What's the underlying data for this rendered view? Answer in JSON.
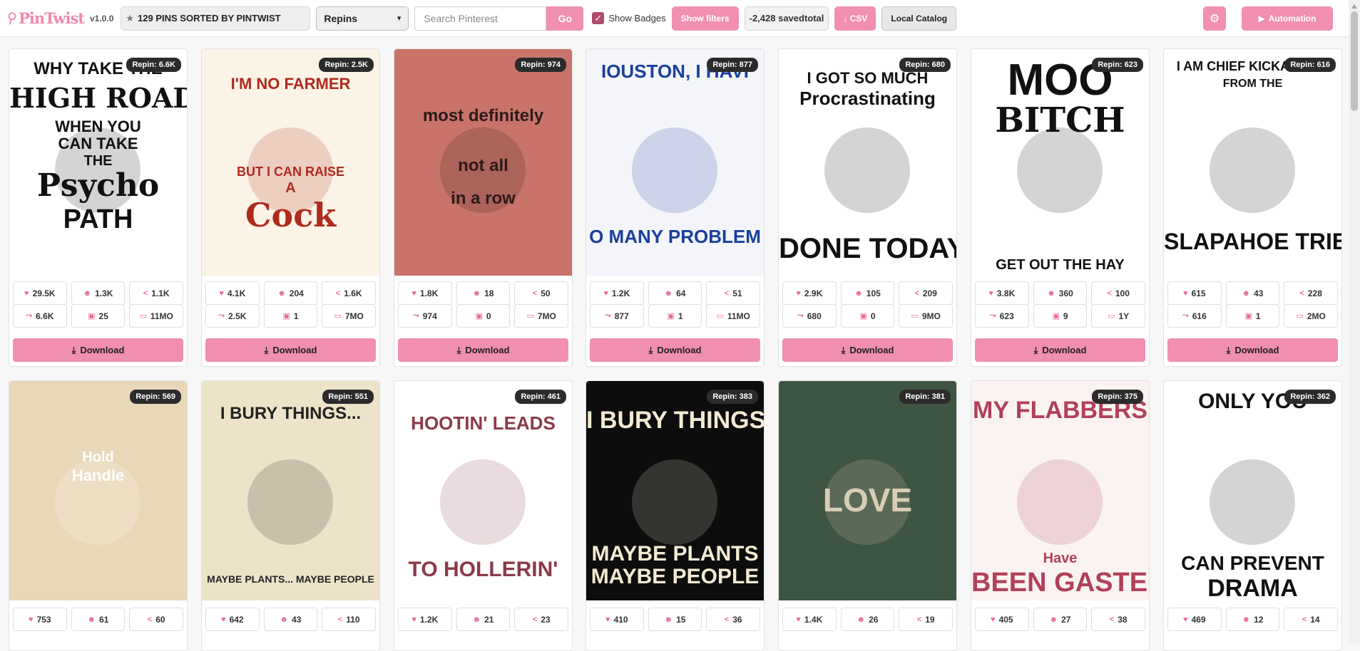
{
  "header": {
    "logo": "PinTwist",
    "version": "v1.0.0",
    "sort_info": "129 PINS SORTED BY PINTWIST",
    "sort_select": "Repins",
    "search_placeholder": "Search Pinterest",
    "go_label": "Go",
    "show_badges_label": "Show Badges",
    "show_filters_label": "Show filters",
    "saved_total": "-2,428 savedtotal",
    "csv_label": "↓ CSV",
    "local_catalog_label": "Local Catalog",
    "automation_label": "Automation"
  },
  "download_label": "Download",
  "pins": [
    {
      "repin": "Repin: 6.6K",
      "likes": "29.5K",
      "reactions": "1.3K",
      "shares": "1.1K",
      "repins": "6.6K",
      "comments": "25",
      "age": "11MO",
      "lines": [
        "WHY TAKE THE",
        "HIGH ROAD?",
        "WHEN YOU",
        "CAN TAKE",
        "THE",
        "Psycho",
        "PATH"
      ]
    },
    {
      "repin": "Repin: 2.5K",
      "likes": "4.1K",
      "reactions": "204",
      "shares": "1.6K",
      "repins": "2.5K",
      "comments": "1",
      "age": "7MO",
      "lines": [
        "I'M NO FARMER",
        "BUT I CAN RAISE",
        "A",
        "Cock"
      ]
    },
    {
      "repin": "Repin: 974",
      "likes": "1.8K",
      "reactions": "18",
      "shares": "50",
      "repins": "974",
      "comments": "0",
      "age": "7MO",
      "lines": [
        "most definitely",
        "not all",
        "in a row"
      ]
    },
    {
      "repin": "Repin: 877",
      "likes": "1.2K",
      "reactions": "64",
      "shares": "51",
      "repins": "877",
      "comments": "1",
      "age": "11MO",
      "lines": [
        "IOUSTON, I HAVI",
        "O MANY PROBLEM"
      ]
    },
    {
      "repin": "Repin: 680",
      "likes": "2.9K",
      "reactions": "105",
      "shares": "209",
      "repins": "680",
      "comments": "0",
      "age": "9MO",
      "lines": [
        "I GOT SO MUCH",
        "Procrastinating",
        "DONE TODAY"
      ]
    },
    {
      "repin": "Repin: 623",
      "likes": "3.8K",
      "reactions": "360",
      "shares": "100",
      "repins": "623",
      "comments": "9",
      "age": "1Y",
      "lines": [
        "MOO",
        "BITCH",
        "GET OUT THE HAY"
      ]
    },
    {
      "repin": "Repin: 616",
      "likes": "615",
      "reactions": "43",
      "shares": "228",
      "repins": "616",
      "comments": "1",
      "age": "2MO",
      "lines": [
        "I AM CHIEF KICKABITCH",
        "FROM THE",
        "SLAPAHOE TRIBE"
      ]
    },
    {
      "repin": "Repin: 569",
      "likes": "753",
      "reactions": "61",
      "shares": "60",
      "lines": [
        "Hold",
        "Handle"
      ]
    },
    {
      "repin": "Repin: 551",
      "likes": "642",
      "reactions": "43",
      "shares": "110",
      "lines": [
        "I BURY THINGS...",
        "MAYBE PLANTS... MAYBE PEOPLE"
      ]
    },
    {
      "repin": "Repin: 461",
      "likes": "1.2K",
      "reactions": "21",
      "shares": "23",
      "lines": [
        "HOOTIN' LEADS",
        "TO HOLLERIN'"
      ]
    },
    {
      "repin": "Repin: 383",
      "likes": "410",
      "reactions": "15",
      "shares": "36",
      "lines": [
        "I BURY THINGS",
        "MAYBE PLANTS",
        "MAYBE PEOPLE"
      ]
    },
    {
      "repin": "Repin: 381",
      "likes": "1.4K",
      "reactions": "26",
      "shares": "19",
      "lines": [
        "LOVE"
      ]
    },
    {
      "repin": "Repin: 375",
      "likes": "405",
      "reactions": "27",
      "shares": "38",
      "lines": [
        "MY FLABBERS",
        "Have",
        "BEEN GASTED"
      ]
    },
    {
      "repin": "Repin: 362",
      "likes": "469",
      "reactions": "12",
      "shares": "14",
      "lines": [
        "ONLY YOU",
        "CAN PREVENT",
        "DRAMA"
      ]
    }
  ]
}
